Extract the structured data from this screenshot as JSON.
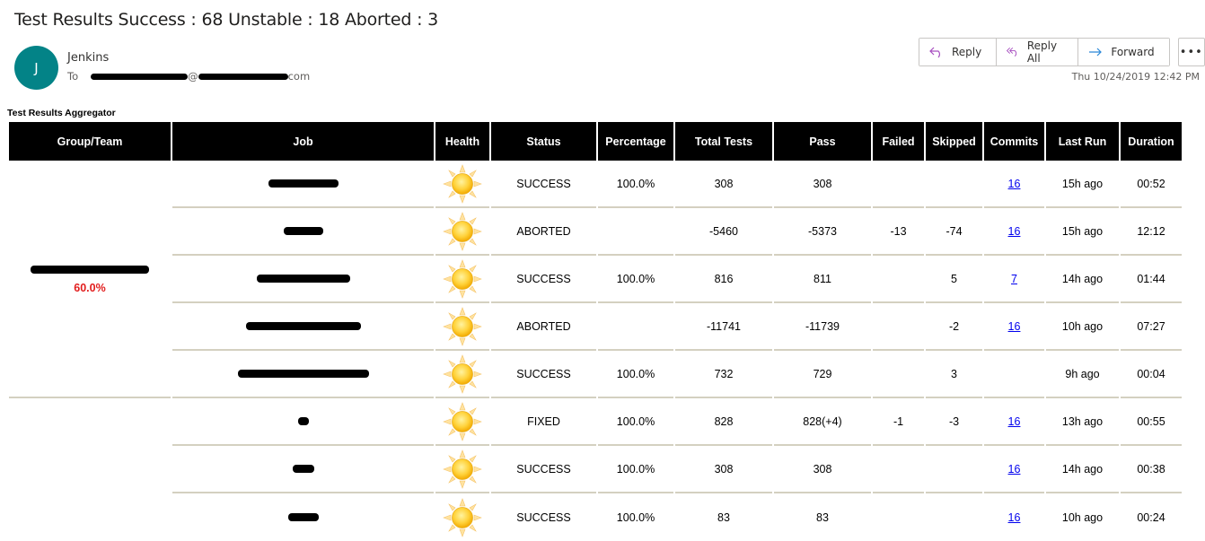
{
  "email": {
    "subject": "Test Results Success : 68 Unstable : 18 Aborted : 3",
    "avatar_initial": "J",
    "sender": "Jenkins",
    "to_label": "To",
    "to_at": "@",
    "to_domain_suffix": "com",
    "datetime": "Thu 10/24/2019 12:42 PM",
    "actions": {
      "reply": "Reply",
      "reply_all": "Reply All",
      "forward": "Forward",
      "more": "•••"
    }
  },
  "report": {
    "title": "Test Results Aggregator",
    "headers": [
      "Group/Team",
      "Job",
      "Health",
      "Status",
      "Percentage",
      "Total Tests",
      "Pass",
      "Failed",
      "Skipped",
      "Commits",
      "Last Run",
      "Duration"
    ],
    "groups": [
      {
        "name": "[redacted]",
        "percentage": "60.0%",
        "rows": [
          {
            "job": "[redacted]",
            "health": "sunny",
            "status": "SUCCESS",
            "percentage": "100.0%",
            "total": "308",
            "pass": "308",
            "failed": "",
            "skipped": "",
            "commits": "16",
            "last_run": "15h ago",
            "duration": "00:52"
          },
          {
            "job": "[redacted]",
            "health": "sunny",
            "status": "ABORTED",
            "percentage": "",
            "total": "-5460",
            "pass": "-5373",
            "failed": "-13",
            "skipped": "-74",
            "commits": "16",
            "last_run": "15h ago",
            "duration": "12:12"
          },
          {
            "job": "[redacted]",
            "health": "sunny",
            "status": "SUCCESS",
            "percentage": "100.0%",
            "total": "816",
            "pass": "811",
            "failed": "",
            "skipped": "5",
            "commits": "7",
            "last_run": "14h ago",
            "duration": "01:44"
          },
          {
            "job": "[redacted]",
            "health": "sunny",
            "status": "ABORTED",
            "percentage": "",
            "total": "-11741",
            "pass": "-11739",
            "failed": "",
            "skipped": "-2",
            "commits": "16",
            "last_run": "10h ago",
            "duration": "07:27"
          },
          {
            "job": "[redacted]",
            "health": "sunny",
            "status": "SUCCESS",
            "percentage": "100.0%",
            "total": "732",
            "pass": "729",
            "failed": "",
            "skipped": "3",
            "commits": "",
            "last_run": "9h ago",
            "duration": "00:04"
          }
        ]
      },
      {
        "name": "",
        "percentage": "",
        "rows": [
          {
            "job": "[redacted]",
            "health": "sunny",
            "status": "FIXED",
            "percentage": "100.0%",
            "total": "828",
            "pass": "828(+4)",
            "failed": "-1",
            "skipped": "-3",
            "commits": "16",
            "last_run": "13h ago",
            "duration": "00:55"
          },
          {
            "job": "[redacted]",
            "health": "sunny",
            "status": "SUCCESS",
            "percentage": "100.0%",
            "total": "308",
            "pass": "308",
            "failed": "",
            "skipped": "",
            "commits": "16",
            "last_run": "14h ago",
            "duration": "00:38"
          },
          {
            "job": "[redacted]",
            "health": "sunny",
            "status": "SUCCESS",
            "percentage": "100.0%",
            "total": "83",
            "pass": "83",
            "failed": "",
            "skipped": "",
            "commits": "16",
            "last_run": "10h ago",
            "duration": "00:24"
          }
        ]
      }
    ]
  },
  "colors": {
    "avatar": "#038387",
    "success": "#1a9b1a",
    "aborted": "#7f7f7f",
    "group_pct": "#e21d1d",
    "link": "#0000ee",
    "header_bg": "#000000"
  }
}
